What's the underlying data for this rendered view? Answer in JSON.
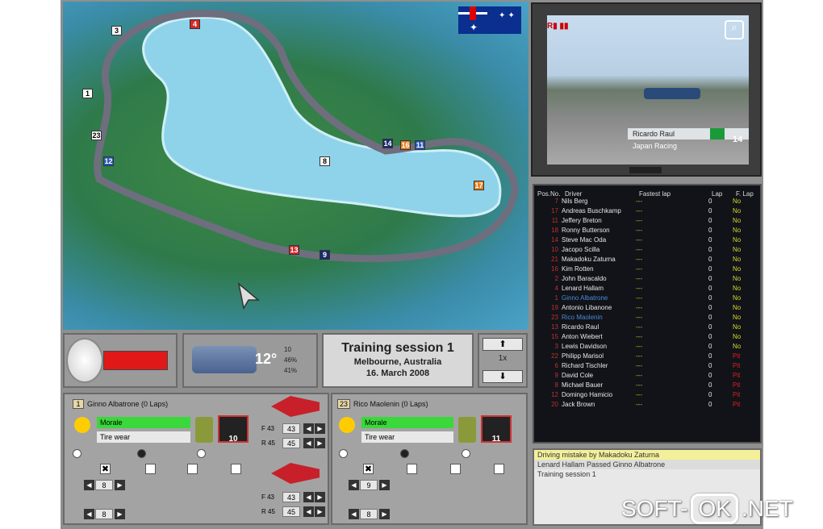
{
  "map": {
    "corner_labels": [
      "3",
      "4",
      "1",
      "23",
      "12",
      "14",
      "16",
      "11",
      "8",
      "17",
      "13",
      "9"
    ]
  },
  "camera": {
    "driver_name": "Ricardo Raul",
    "team": "Japan Racing",
    "car_number": "14"
  },
  "standings": {
    "headers": [
      "Pos.No.",
      "Driver",
      "Fastest lap",
      "Lap",
      "F. Lap"
    ],
    "rows": [
      {
        "pos": "7",
        "driver": "Nils Berg",
        "fast": "---",
        "lap": "0",
        "flap": "No"
      },
      {
        "pos": "17",
        "driver": "Andreas Buschkamp",
        "fast": "---",
        "lap": "0",
        "flap": "No"
      },
      {
        "pos": "11",
        "driver": "Jeffery Breton",
        "fast": "---",
        "lap": "0",
        "flap": "No"
      },
      {
        "pos": "18",
        "driver": "Ronny Butterson",
        "fast": "---",
        "lap": "0",
        "flap": "No"
      },
      {
        "pos": "14",
        "driver": "Steve Mac Oda",
        "fast": "---",
        "lap": "0",
        "flap": "No"
      },
      {
        "pos": "10",
        "driver": "Jacopo Scilla",
        "fast": "---",
        "lap": "0",
        "flap": "No"
      },
      {
        "pos": "21",
        "driver": "Makadoku Zaturna",
        "fast": "---",
        "lap": "0",
        "flap": "No"
      },
      {
        "pos": "16",
        "driver": "Kim Rotten",
        "fast": "---",
        "lap": "0",
        "flap": "No"
      },
      {
        "pos": "2",
        "driver": "John Baracaldo",
        "fast": "---",
        "lap": "0",
        "flap": "No"
      },
      {
        "pos": "4",
        "driver": "Lenard Hallam",
        "fast": "---",
        "lap": "0",
        "flap": "No"
      },
      {
        "pos": "1",
        "driver": "Ginno Albatrone",
        "fast": "---",
        "lap": "0",
        "flap": "No"
      },
      {
        "pos": "19",
        "driver": "Antonio Libanone",
        "fast": "---",
        "lap": "0",
        "flap": "No"
      },
      {
        "pos": "23",
        "driver": "Rico Maolenin",
        "fast": "---",
        "lap": "0",
        "flap": "No"
      },
      {
        "pos": "13",
        "driver": "Ricardo Raul",
        "fast": "---",
        "lap": "0",
        "flap": "No"
      },
      {
        "pos": "15",
        "driver": "Anton Wiebert",
        "fast": "---",
        "lap": "0",
        "flap": "No"
      },
      {
        "pos": "3",
        "driver": "Lewis Davidson",
        "fast": "---",
        "lap": "0",
        "flap": "No"
      },
      {
        "pos": "22",
        "driver": "Philipp Marisol",
        "fast": "---",
        "lap": "0",
        "flap": "Pit"
      },
      {
        "pos": "6",
        "driver": "Richard Tischler",
        "fast": "---",
        "lap": "0",
        "flap": "Pit"
      },
      {
        "pos": "9",
        "driver": "David Cole",
        "fast": "---",
        "lap": "0",
        "flap": "Pit"
      },
      {
        "pos": "8",
        "driver": "Michael Bauer",
        "fast": "---",
        "lap": "0",
        "flap": "Pit"
      },
      {
        "pos": "12",
        "driver": "Domingo Hamicio",
        "fast": "---",
        "lap": "0",
        "flap": "Pit"
      },
      {
        "pos": "20",
        "driver": "Jack Brown",
        "fast": "---",
        "lap": "0",
        "flap": "Pit"
      }
    ]
  },
  "weather": {
    "temp": "12°",
    "stats": [
      "10",
      "46%",
      "41%"
    ]
  },
  "session": {
    "title": "Training session 1",
    "location": "Melbourne, Australia",
    "date": "16. March 2008"
  },
  "speed": {
    "label": "1x"
  },
  "driver_left": {
    "number": "1",
    "header": "Ginno Albatrone (0 Laps)",
    "morale": "Morale",
    "tire": "Tire wear",
    "pit_num": "10",
    "f_label": "F 43",
    "f_val": "43",
    "r_label": "R 45",
    "r_val": "45",
    "stepper1": "8",
    "stepper2": "8"
  },
  "driver_right": {
    "number": "23",
    "header": "Rico Maolenin (0 Laps)",
    "morale": "Morale",
    "tire": "Tire wear",
    "pit_num": "11",
    "f_label": "F 43",
    "f_val": "43",
    "r_label": "R 45",
    "r_val": "45",
    "stepper1": "9",
    "stepper2": "8"
  },
  "messages": [
    "Driving mistake by Makadoku Zaturna",
    "Lenard Hallam Passed Ginno Albatrone",
    "Training session 1"
  ],
  "watermark": {
    "left": "SOFT-",
    "mid": "OK",
    "right": ".NET"
  },
  "colors": {
    "accent_red": "#e01818",
    "morale_green": "#3ad83a",
    "flap_pit": "#e02020",
    "flap_no": "#d8d830"
  }
}
